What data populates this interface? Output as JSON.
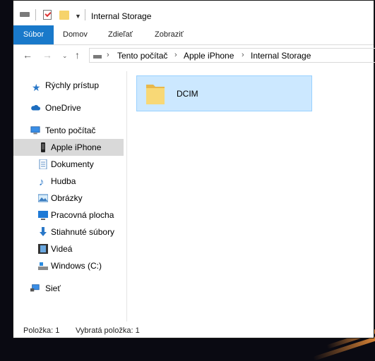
{
  "titlebar": {
    "title": "Internal Storage"
  },
  "ribbon": {
    "tabs": [
      {
        "label": "Súbor"
      },
      {
        "label": "Domov"
      },
      {
        "label": "Zdieľať"
      },
      {
        "label": "Zobraziť"
      }
    ]
  },
  "address": {
    "crumbs": [
      "Tento počítač",
      "Apple iPhone",
      "Internal Storage"
    ]
  },
  "nav": {
    "items": [
      {
        "label": "Rýchly prístup",
        "icon": "star-icon"
      },
      {
        "label": "OneDrive",
        "icon": "cloud-icon"
      },
      {
        "label": "Tento počítač",
        "icon": "computer-icon"
      },
      {
        "label": "Apple iPhone",
        "icon": "phone-icon"
      },
      {
        "label": "Dokumenty",
        "icon": "document-icon"
      },
      {
        "label": "Hudba",
        "icon": "music-icon"
      },
      {
        "label": "Obrázky",
        "icon": "pictures-icon"
      },
      {
        "label": "Pracovná plocha",
        "icon": "desktop-icon"
      },
      {
        "label": "Stiahnuté súbory",
        "icon": "download-icon"
      },
      {
        "label": "Videá",
        "icon": "video-icon"
      },
      {
        "label": "Windows (C:)",
        "icon": "drive-icon"
      },
      {
        "label": "Sieť",
        "icon": "network-icon"
      }
    ],
    "selected": "Apple iPhone"
  },
  "content": {
    "items": [
      {
        "name": "DCIM",
        "icon": "folder-icon"
      }
    ]
  },
  "status": {
    "item_count": "Položka: 1",
    "selected_count": "Vybratá položka: 1"
  },
  "colors": {
    "accent": "#1979ca",
    "selection": "#cce8ff",
    "selection_border": "#99d1ff",
    "folder": "#f6d36b"
  }
}
